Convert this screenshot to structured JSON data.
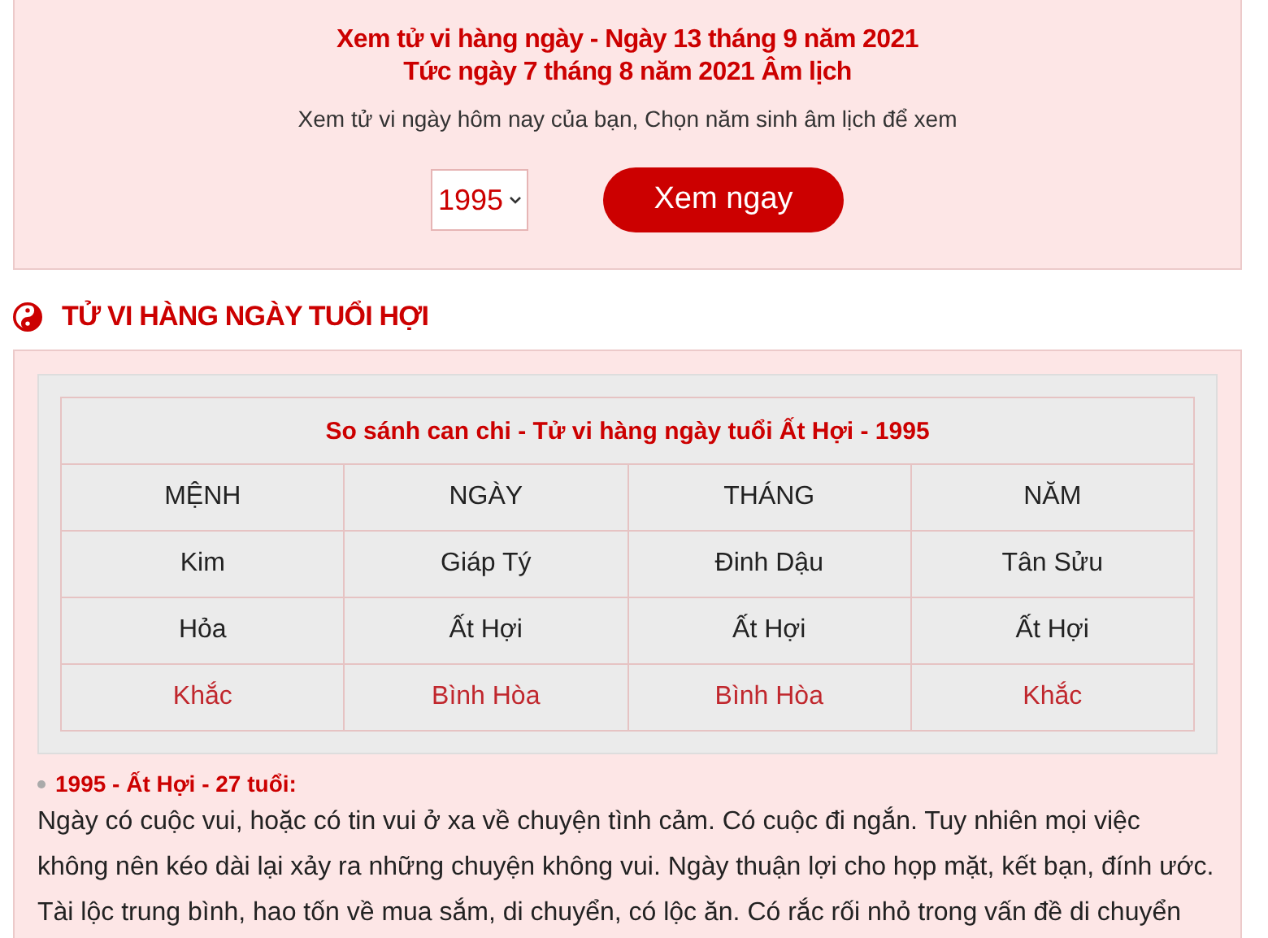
{
  "intro": {
    "title_lines": [
      "Xem tử vi hàng ngày - Ngày 13 tháng 9 năm 2021",
      "Tức ngày 7 tháng 8 năm 2021 Âm lịch"
    ],
    "subtitle": "Xem tử vi ngày hôm nay của bạn, Chọn năm sinh âm lịch để xem",
    "year_select": {
      "value": "1995"
    },
    "button": "Xem ngay"
  },
  "section": {
    "heading": "TỬ VI HÀNG NGÀY TUỔI HỢI",
    "table": {
      "caption": "So sánh can chi - Tử vi hàng ngày tuổi Ất Hợi - 1995",
      "columns": [
        "MỆNH",
        "NGÀY",
        "THÁNG",
        "NĂM"
      ],
      "rows": [
        {
          "kind": "plain",
          "cells": [
            "Kim",
            "Giáp Tý",
            "Đinh Dậu",
            "Tân Sửu"
          ]
        },
        {
          "kind": "plain",
          "cells": [
            "Hỏa",
            "Ất Hợi",
            "Ất Hợi",
            "Ất Hợi"
          ]
        },
        {
          "kind": "relation",
          "cells": [
            "Khắc",
            "Bình Hòa",
            "Bình Hòa",
            "Khắc"
          ]
        }
      ]
    },
    "entry": {
      "label": "1995 - Ất Hợi - 27 tuổi:",
      "text": "Ngày có cuộc vui, hoặc có tin vui ở xa về chuyện tình cảm. Có cuộc đi ngắn. Tuy nhiên mọi việc không nên kéo dài lại xảy ra những chuyện không vui. Ngày thuận lợi cho họp mặt, kết bạn, đính ước. Tài lộc trung bình, hao tốn về mua sắm, di chuyển, có lộc ăn. Có rắc rối nhỏ trong vấn đề di chuyển"
    }
  }
}
